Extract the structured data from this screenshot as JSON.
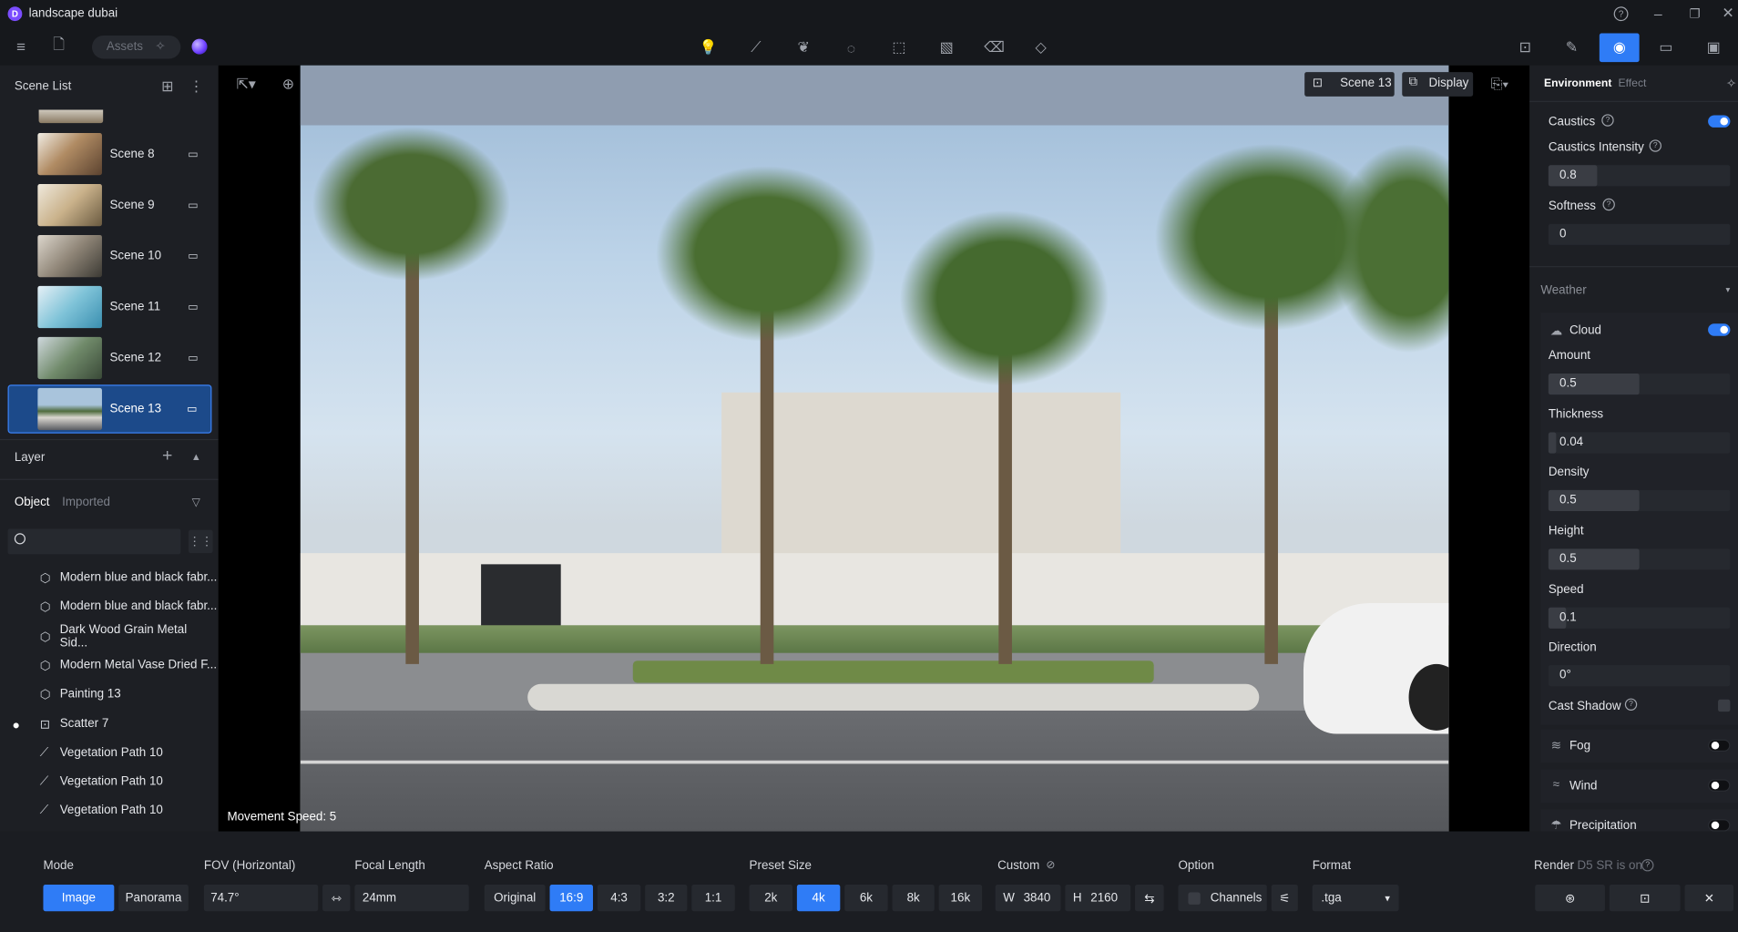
{
  "window": {
    "title": "landscape dubai"
  },
  "toolbar": {
    "assets_label": "Assets"
  },
  "scene_list": {
    "title": "Scene List",
    "items": [
      {
        "label": "Scene 8"
      },
      {
        "label": "Scene 9"
      },
      {
        "label": "Scene 10"
      },
      {
        "label": "Scene 11"
      },
      {
        "label": "Scene 12"
      },
      {
        "label": "Scene 13"
      }
    ]
  },
  "layer": {
    "title": "Layer",
    "tabs": [
      "Object",
      "Imported"
    ]
  },
  "objects": [
    {
      "label": "Modern blue and black fabr..."
    },
    {
      "label": "Modern blue and black fabr..."
    },
    {
      "label": "Dark Wood Grain Metal Sid..."
    },
    {
      "label": "Modern Metal Vase Dried F..."
    },
    {
      "label": "Painting 13"
    },
    {
      "label": "Scatter 7"
    },
    {
      "label": "Vegetation Path 10"
    },
    {
      "label": "Vegetation Path 10"
    },
    {
      "label": "Vegetation Path 10"
    }
  ],
  "viewport": {
    "scene_label": "Scene 13",
    "display_label": "Display",
    "movement_speed": "Movement Speed: 5"
  },
  "right_panel": {
    "tabs": [
      "Environment",
      "Effect"
    ],
    "caustics": "Caustics",
    "caustics_intensity": "Caustics Intensity",
    "caustics_intensity_value": "0.8",
    "softness": "Softness",
    "softness_value": "0",
    "weather": "Weather",
    "cloud": "Cloud",
    "amount": "Amount",
    "amount_value": "0.5",
    "thickness": "Thickness",
    "thickness_value": "0.04",
    "density": "Density",
    "density_value": "0.5",
    "height": "Height",
    "height_value": "0.5",
    "speed": "Speed",
    "speed_value": "0.1",
    "direction": "Direction",
    "direction_value": "0°",
    "cast_shadow": "Cast Shadow",
    "fog": "Fog",
    "wind": "Wind",
    "precipitation": "Precipitation"
  },
  "bottom": {
    "mode_label": "Mode",
    "mode_image": "Image",
    "mode_panorama": "Panorama",
    "fov_label": "FOV (Horizontal)",
    "fov_value": "74.7°",
    "focal_label": "Focal Length",
    "focal_value": "24mm",
    "aspect_label": "Aspect Ratio",
    "aspect": [
      "Original",
      "16:9",
      "4:3",
      "3:2",
      "1:1"
    ],
    "preset_label": "Preset Size",
    "preset": [
      "2k",
      "4k",
      "6k",
      "8k",
      "16k"
    ],
    "custom_label": "Custom",
    "width_label": "W",
    "width_value": "3840",
    "height_label": "H",
    "height_value": "2160",
    "option_label": "Option",
    "channels_label": "Channels",
    "format_label": "Format",
    "format_value": ".tga",
    "render_label": "Render",
    "render_note": "D5 SR is on"
  },
  "colors": {
    "accent": "#2f7cf6",
    "panel": "#1d1f24",
    "background": "#1b1d22"
  }
}
